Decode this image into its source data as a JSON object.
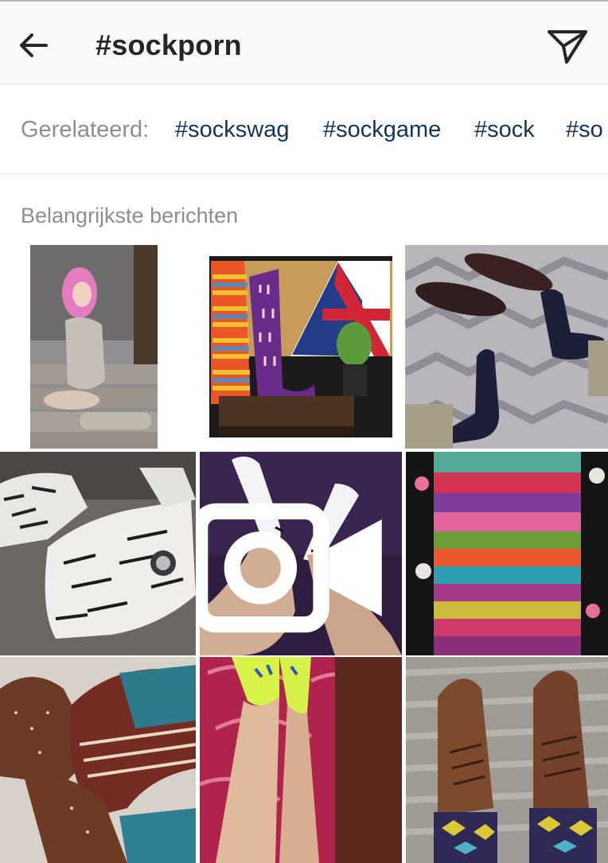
{
  "header": {
    "title": "#sockporn",
    "back_icon": "arrow-left-icon",
    "share_icon": "paper-plane-icon"
  },
  "related": {
    "label": "Gerelateerd:",
    "tags": [
      "#sockswag",
      "#sockgame",
      "#sock",
      "#so"
    ]
  },
  "section": {
    "title": "Belangrijkste berichten"
  },
  "grid": {
    "posts": [
      {
        "subject": "woman in grey bodysuit kneeling on stairs"
      },
      {
        "subject": "striped socks display with union jack"
      },
      {
        "subject": "dark socks and dress shoes on patterned carpet"
      },
      {
        "subject": "black and white doodle sneakers"
      },
      {
        "subject": "white ankle socks on purple background",
        "badge": "video-camera-icon"
      },
      {
        "subject": "knitted rainbow striped sock"
      },
      {
        "subject": "brown patterned socks on carpet"
      },
      {
        "subject": "neon yellow ankle socks on pink blanket"
      },
      {
        "subject": "brown brogue shoes with argyle socks"
      }
    ]
  },
  "colors": {
    "header_bg": "#fafafa",
    "tag_link": "#13325e",
    "muted_text": "#8e8e8e",
    "title_text": "#262626"
  }
}
